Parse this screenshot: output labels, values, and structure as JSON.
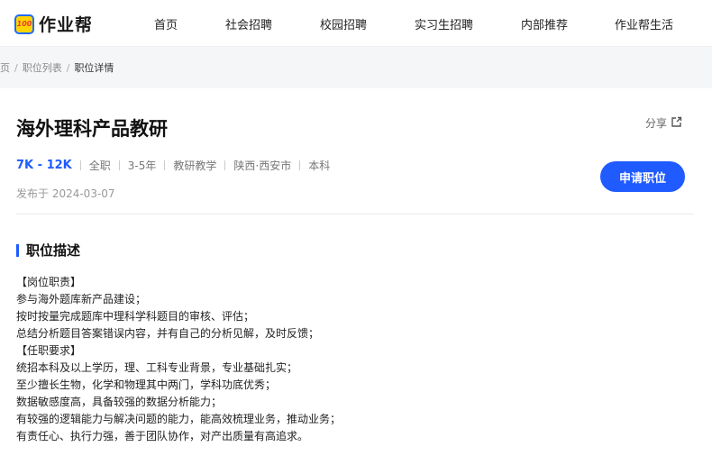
{
  "nav": {
    "logo_mark": "100",
    "logo_text": "作业帮",
    "items": [
      "首页",
      "社会招聘",
      "校园招聘",
      "实习生招聘",
      "内部推荐",
      "作业帮生活"
    ]
  },
  "breadcrumb": {
    "home": "页",
    "list": "职位列表",
    "current": "职位详情"
  },
  "job": {
    "title": "海外理科产品教研",
    "share_label": "分享",
    "salary": "7K - 12K",
    "tags": [
      "全职",
      "3-5年",
      "教研教学",
      "陕西·西安市",
      "本科"
    ],
    "posted": "发布于 2024-03-07",
    "apply_label": "申请职位"
  },
  "description": {
    "title": "职位描述",
    "lines": [
      "【岗位职责】",
      "参与海外题库新产品建设；",
      "按时按量完成题库中理科学科题目的审核、评估；",
      "总结分析题目答案错误内容，并有自己的分析见解，及时反馈；",
      "【任职要求】",
      "统招本科及以上学历，理、工科专业背景，专业基础扎实；",
      "至少擅长生物，化学和物理其中两门，学科功底优秀；",
      "数据敏感度高，具备较强的数据分析能力；",
      "有较强的逻辑能力与解决问题的能力，能高效梳理业务，推动业务；",
      "有责任心、执行力强，善于团队协作，对产出质量有高追求。"
    ]
  },
  "colors": {
    "accent": "#1f5bff",
    "logo_yellow": "#ffd400",
    "crumb_bg": "#f5f6f8"
  },
  "icons": {
    "share": "share-external-icon"
  }
}
